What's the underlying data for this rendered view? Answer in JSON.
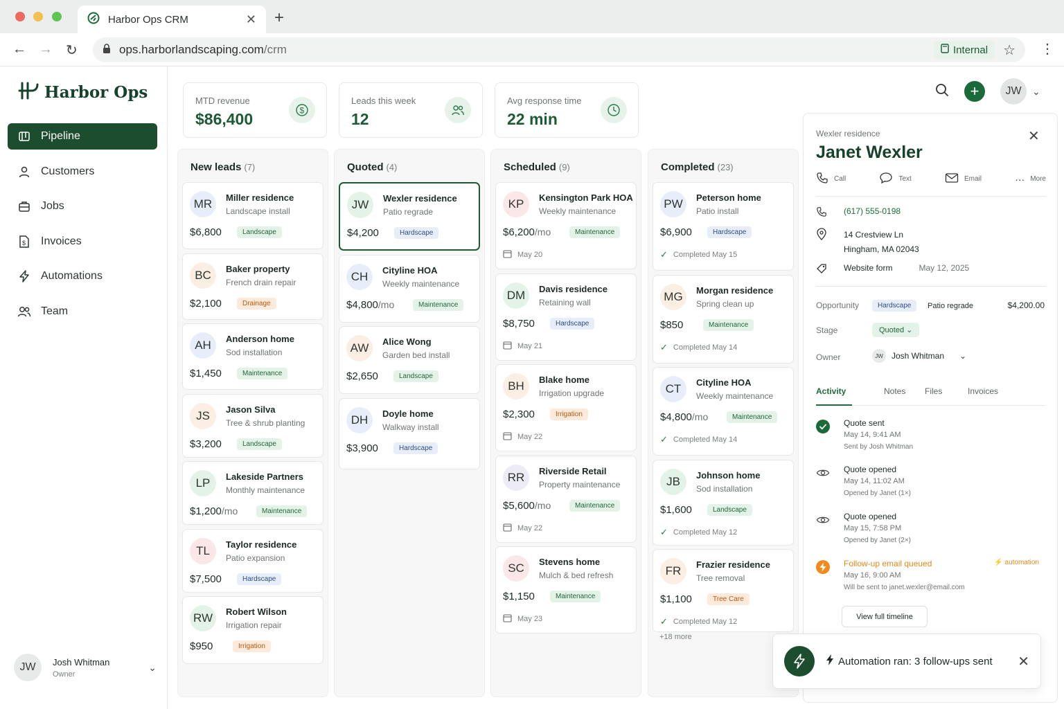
{
  "browser": {
    "tab_title": "Harbor Ops CRM",
    "url_host": "ops.harborlandscaping.com",
    "url_path": "/crm",
    "chip_label": "Internal"
  },
  "brand": {
    "name": "Harbor Ops"
  },
  "nav": [
    {
      "label": "Pipeline",
      "icon": "pipeline-icon",
      "active": true
    },
    {
      "label": "Customers",
      "icon": "user-icon"
    },
    {
      "label": "Jobs",
      "icon": "briefcase-icon"
    },
    {
      "label": "Invoices",
      "icon": "invoice-icon"
    },
    {
      "label": "Automations",
      "icon": "bolt-icon"
    },
    {
      "label": "Team",
      "icon": "team-icon"
    }
  ],
  "current_user": {
    "initials": "JW",
    "name": "Josh Whitman",
    "role": "Owner"
  },
  "stats": [
    {
      "label": "MTD revenue",
      "value": "$86,400",
      "icon": "dollar-icon"
    },
    {
      "label": "Leads this week",
      "value": "12",
      "icon": "people-icon"
    },
    {
      "label": "Avg response time",
      "value": "22 min",
      "icon": "clock-icon"
    }
  ],
  "header_avatar": "JW",
  "columns": [
    {
      "title": "New leads",
      "count": "(7)",
      "cards": [
        {
          "initials": "MR",
          "name": "Miller residence",
          "sub": "Landscape install",
          "amount": "$6,800",
          "per": "",
          "tag": "Landscape",
          "tag_type": "landscape",
          "avatar_bg": "#e8eef9"
        },
        {
          "initials": "BC",
          "name": "Baker property",
          "sub": "French drain repair",
          "amount": "$2,100",
          "per": "",
          "tag": "Drainage",
          "tag_type": "drainage",
          "avatar_bg": "#fbeee2"
        },
        {
          "initials": "AH",
          "name": "Anderson home",
          "sub": "Sod installation",
          "amount": "$1,450",
          "per": "",
          "tag": "Maintenance",
          "tag_type": "maintenance",
          "avatar_bg": "#e8eef9"
        },
        {
          "initials": "JS",
          "name": "Jason Silva",
          "sub": "Tree & shrub planting",
          "amount": "$3,200",
          "per": "",
          "tag": "Landscape",
          "tag_type": "landscape",
          "avatar_bg": "#fbeee2"
        },
        {
          "initials": "LP",
          "name": "Lakeside Partners",
          "sub": "Monthly maintenance",
          "amount": "$1,200",
          "per": "/mo",
          "tag": "Maintenance",
          "tag_type": "maintenance",
          "avatar_bg": "#e4f3e8"
        },
        {
          "initials": "TL",
          "name": "Taylor residence",
          "sub": "Patio expansion",
          "amount": "$7,500",
          "per": "",
          "tag": "Hardscape",
          "tag_type": "hardscape",
          "avatar_bg": "#fbe7e7"
        },
        {
          "initials": "RW",
          "name": "Robert Wilson",
          "sub": "Irrigation repair",
          "amount": "$950",
          "per": "",
          "tag": "Irrigation",
          "tag_type": "irrigation",
          "avatar_bg": "#e4f3e8"
        }
      ]
    },
    {
      "title": "Quoted",
      "count": "(4)",
      "cards": [
        {
          "initials": "JW",
          "name": "Wexler residence",
          "sub": "Patio regrade",
          "amount": "$4,200",
          "per": "",
          "tag": "Hardscape",
          "tag_type": "hardscape",
          "avatar_bg": "#e4f3e8",
          "selected": true
        },
        {
          "initials": "CH",
          "name": "Cityline HOA",
          "sub": "Weekly maintenance",
          "amount": "$4,800",
          "per": "/mo",
          "tag": "Maintenance",
          "tag_type": "maintenance",
          "avatar_bg": "#e8eef9"
        },
        {
          "initials": "AW",
          "name": "Alice Wong",
          "sub": "Garden bed install",
          "amount": "$2,650",
          "per": "",
          "tag": "Landscape",
          "tag_type": "landscape",
          "avatar_bg": "#fbeee2"
        },
        {
          "initials": "DH",
          "name": "Doyle home",
          "sub": "Walkway install",
          "amount": "$3,900",
          "per": "",
          "tag": "Hardscape",
          "tag_type": "hardscape",
          "avatar_bg": "#e8eef9"
        }
      ]
    },
    {
      "title": "Scheduled",
      "count": "(9)",
      "cards": [
        {
          "initials": "KP",
          "name": "Kensington Park HOA",
          "sub": "Weekly maintenance",
          "amount": "$6,200",
          "per": "/mo",
          "tag": "Maintenance",
          "tag_type": "maintenance",
          "avatar_bg": "#fbe7e7",
          "date": "May 20"
        },
        {
          "initials": "DM",
          "name": "Davis residence",
          "sub": "Retaining wall",
          "amount": "$8,750",
          "per": "",
          "tag": "Hardscape",
          "tag_type": "hardscape",
          "avatar_bg": "#e4f3e8",
          "date": "May 21"
        },
        {
          "initials": "BH",
          "name": "Blake home",
          "sub": "Irrigation upgrade",
          "amount": "$2,300",
          "per": "",
          "tag": "Irrigation",
          "tag_type": "irrigation",
          "avatar_bg": "#fbeee2",
          "date": "May 22"
        },
        {
          "initials": "RR",
          "name": "Riverside Retail",
          "sub": "Property maintenance",
          "amount": "$5,600",
          "per": "/mo",
          "tag": "Maintenance",
          "tag_type": "maintenance",
          "avatar_bg": "#ecebf6",
          "date": "May 22"
        },
        {
          "initials": "SC",
          "name": "Stevens home",
          "sub": "Mulch & bed refresh",
          "amount": "$1,150",
          "per": "",
          "tag": "Maintenance",
          "tag_type": "maintenance",
          "avatar_bg": "#fbe7e7",
          "date": "May 23"
        }
      ]
    },
    {
      "title": "Completed",
      "count": "(23)",
      "more": "+18 more",
      "cards": [
        {
          "initials": "PW",
          "name": "Peterson home",
          "sub": "Patio install",
          "amount": "$6,900",
          "per": "",
          "tag": "Hardscape",
          "tag_type": "hardscape",
          "avatar_bg": "#e8eef9",
          "date": "Completed May 15"
        },
        {
          "initials": "MG",
          "name": "Morgan residence",
          "sub": "Spring clean up",
          "amount": "$850",
          "per": "",
          "tag": "Maintenance",
          "tag_type": "maintenance",
          "avatar_bg": "#fbeee2",
          "date": "Completed May 14"
        },
        {
          "initials": "CT",
          "name": "Cityline HOA",
          "sub": "Weekly maintenance",
          "amount": "$4,800",
          "per": "/mo",
          "tag": "Maintenance",
          "tag_type": "maintenance",
          "avatar_bg": "#e8eef9",
          "date": "Completed May 14"
        },
        {
          "initials": "JB",
          "name": "Johnson home",
          "sub": "Sod installation",
          "amount": "$1,600",
          "per": "",
          "tag": "Landscape",
          "tag_type": "landscape",
          "avatar_bg": "#e4f3e8",
          "date": "Completed May 12"
        },
        {
          "initials": "FR",
          "name": "Frazier residence",
          "sub": "Tree removal",
          "amount": "$1,100",
          "per": "",
          "tag": "Tree Care",
          "tag_type": "treecare",
          "avatar_bg": "#fbeee2",
          "date": "Completed May 12"
        }
      ]
    }
  ],
  "detail": {
    "subtitle": "Wexler residence",
    "title": "Janet Wexler",
    "actions": [
      "Call",
      "Text",
      "Email",
      "More"
    ],
    "phone": "(617) 555-0198",
    "address_1": "14 Crestview Ln",
    "address_2": "Hingham, MA 02043",
    "source": "Website form",
    "source_date": "May 12, 2025",
    "opportunity_label": "Opportunity",
    "opportunity_tag": "Hardscape",
    "opportunity_desc": "Patio regrade",
    "opportunity_amount": "$4,200.00",
    "stage_label": "Stage",
    "stage_value": "Quoted",
    "owner_label": "Owner",
    "owner_initials": "JW",
    "owner_name": "Josh Whitman",
    "tabs": [
      "Activity",
      "Notes",
      "Files",
      "Invoices"
    ],
    "activity": [
      {
        "title": "Quote sent",
        "line2": "May 14, 9:41 AM",
        "line3": "Sent by Josh Whitman",
        "icon": "check-circle-icon"
      },
      {
        "title": "Quote opened",
        "line2": "May 14, 11:02 AM",
        "line3": "Opened by Janet (1×)",
        "icon": "eye-icon"
      },
      {
        "title": "Quote opened",
        "line2": "May 15, 7:58 PM",
        "line3": "Opened by Janet (2×)",
        "icon": "eye-icon"
      },
      {
        "title": "Follow-up email queued",
        "line2": "May 16, 9:00 AM",
        "line3": "Will be sent to janet.wexler@email.com",
        "icon": "bolt-icon",
        "badge": "automation"
      }
    ],
    "timeline_button": "View full timeline"
  },
  "toast": {
    "message": "Automation ran: 3 follow-ups sent"
  },
  "colors": {
    "brand": "#1b4d2e",
    "accent": "#1e6b3d",
    "warning": "#e08a1a"
  }
}
